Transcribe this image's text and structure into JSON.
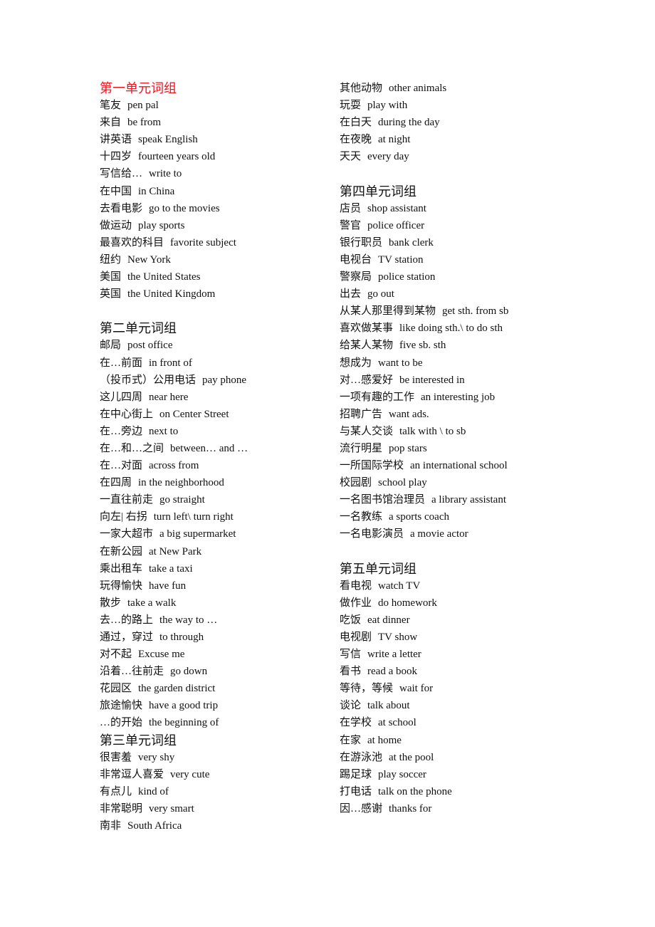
{
  "left_column": [
    {
      "heading": "第一单元词组",
      "color": "#f0141e"
    },
    {
      "cn": "笔友",
      "en": "pen pal"
    },
    {
      "cn": "来自",
      "en": "be from"
    },
    {
      "cn": "讲英语",
      "en": "speak English"
    },
    {
      "cn": "十四岁",
      "en": "fourteen years old"
    },
    {
      "cn": "写信给…",
      "en": "write to"
    },
    {
      "cn": "在中国",
      "en": "in China"
    },
    {
      "cn": "去看电影",
      "en": "go to the movies"
    },
    {
      "cn": "做运动",
      "en": "play sports"
    },
    {
      "cn": "最喜欢的科目",
      "en": "favorite subject"
    },
    {
      "cn": "纽约",
      "en": "New York"
    },
    {
      "cn": "美国",
      "en": "the United States"
    },
    {
      "cn": "英国",
      "en": "the United Kingdom"
    },
    {},
    {
      "heading": "第二单元词组"
    },
    {
      "cn": "邮局",
      "en": "post office"
    },
    {
      "cn": "在…前面",
      "en": "in front of"
    },
    {
      "cn": "（投币式）公用电话",
      "en": "pay phone"
    },
    {
      "cn": "这儿四周",
      "en": "near here"
    },
    {
      "cn": "在中心街上",
      "en": "on Center Street"
    },
    {
      "cn": "在…旁边",
      "en": "next to"
    },
    {
      "cn": "在…和…之间",
      "en": "between…  and  …"
    },
    {
      "cn": "在…对面",
      "en": "across from"
    },
    {
      "cn": "在四周",
      "en": "in the neighborhood"
    },
    {
      "cn": "一直往前走",
      "en": "go straight"
    },
    {
      "cn": "向左|  右拐",
      "en": "turn left\\ turn right"
    },
    {
      "cn": "一家大超市",
      "en": "a big supermarket"
    },
    {
      "cn": "在新公园",
      "en": "at New Park"
    },
    {
      "cn": "乘出租车",
      "en": "take a taxi"
    },
    {
      "cn": "玩得愉快",
      "en": "have fun"
    },
    {
      "cn": "散步",
      "en": "take a walk"
    },
    {
      "cn": "去…的路上",
      "en": "the way to  …"
    },
    {
      "cn": "通过，穿过",
      "en": "to through"
    },
    {
      "cn": "对不起",
      "en": "Excuse me"
    },
    {
      "cn": "沿着…往前走",
      "en": "go down"
    },
    {
      "cn": "花园区",
      "en": "the garden district"
    },
    {
      "cn": "旅途愉快",
      "en": "have a good trip"
    },
    {
      "cn": "…的开始",
      "en": "the beginning of"
    },
    {
      "heading": "第三单元词组"
    },
    {
      "cn": "很害羞",
      "en": "very shy"
    },
    {
      "cn": "非常逗人喜爱",
      "en": "very cute"
    },
    {
      "cn": "有点儿",
      "en": "kind of"
    },
    {
      "cn": "非常聪明",
      "en": "very smart"
    },
    {
      "cn": "南非",
      "en": "South Africa"
    }
  ],
  "right_column": [
    {
      "cn": "其他动物",
      "en": "other animals"
    },
    {
      "cn": "玩耍",
      "en": "play with"
    },
    {
      "cn": "在白天",
      "en": "during the day"
    },
    {
      "cn": "在夜晚",
      "en": "at night"
    },
    {
      "cn": "天天",
      "en": "every day"
    },
    {},
    {
      "heading": "第四单元词组"
    },
    {
      "cn": "店员",
      "en": "shop assistant"
    },
    {
      "cn": "警官",
      "en": "police officer"
    },
    {
      "cn": "银行职员",
      "en": "bank clerk"
    },
    {
      "cn": "电视台",
      "en": "TV station"
    },
    {
      "cn": "警察局",
      "en": "police station"
    },
    {
      "cn": "出去",
      "en": "go out"
    },
    {
      "cn": "从某人那里得到某物",
      "en": "get sth. from sb"
    },
    {
      "cn": "喜欢做某事",
      "en": "like doing sth.\\ to do sth"
    },
    {
      "cn": "给某人某物",
      "en": "five sb. sth"
    },
    {
      "cn": "想成为",
      "en": "want to be"
    },
    {
      "cn": "对…感爱好",
      "en": "be interested in"
    },
    {
      "cn": "一项有趣的工作",
      "en": "an interesting job"
    },
    {
      "cn": "招聘广告",
      "en": "want ads."
    },
    {
      "cn": "与某人交谈",
      "en": "talk with \\ to sb"
    },
    {
      "cn": "流行明星",
      "en": "pop stars"
    },
    {
      "cn": "一所国际学校",
      "en": "an international school"
    },
    {
      "cn": "校园剧",
      "en": "school play"
    },
    {
      "cn": "一名图书馆治理员",
      "en": "a library assistant"
    },
    {
      "cn": "一名教练",
      "en": "a sports coach"
    },
    {
      "cn": "一名电影演员",
      "en": "a movie actor"
    },
    {},
    {
      "heading": "第五单元词组"
    },
    {
      "cn": "看电视",
      "en": "watch TV"
    },
    {
      "cn": "做作业",
      "en": "do homework"
    },
    {
      "cn": "吃饭",
      "en": "eat dinner"
    },
    {
      "cn": "电视剧",
      "en": "TV show"
    },
    {
      "cn": "写信",
      "en": "write a letter"
    },
    {
      "cn": "看书",
      "en": "read a book"
    },
    {
      "cn": "等待，等候",
      "en": "wait for"
    },
    {
      "cn": "谈论",
      "en": "talk about"
    },
    {
      "cn": "在学校",
      "en": "at school"
    },
    {
      "cn": "在家",
      "en": "at home"
    },
    {
      "cn": "在游泳池",
      "en": "at the pool"
    },
    {
      "cn": "踢足球",
      "en": "play soccer"
    },
    {
      "cn": "打电话",
      "en": "talk on the phone"
    },
    {
      "cn": "因…感谢",
      "en": "thanks for"
    }
  ]
}
